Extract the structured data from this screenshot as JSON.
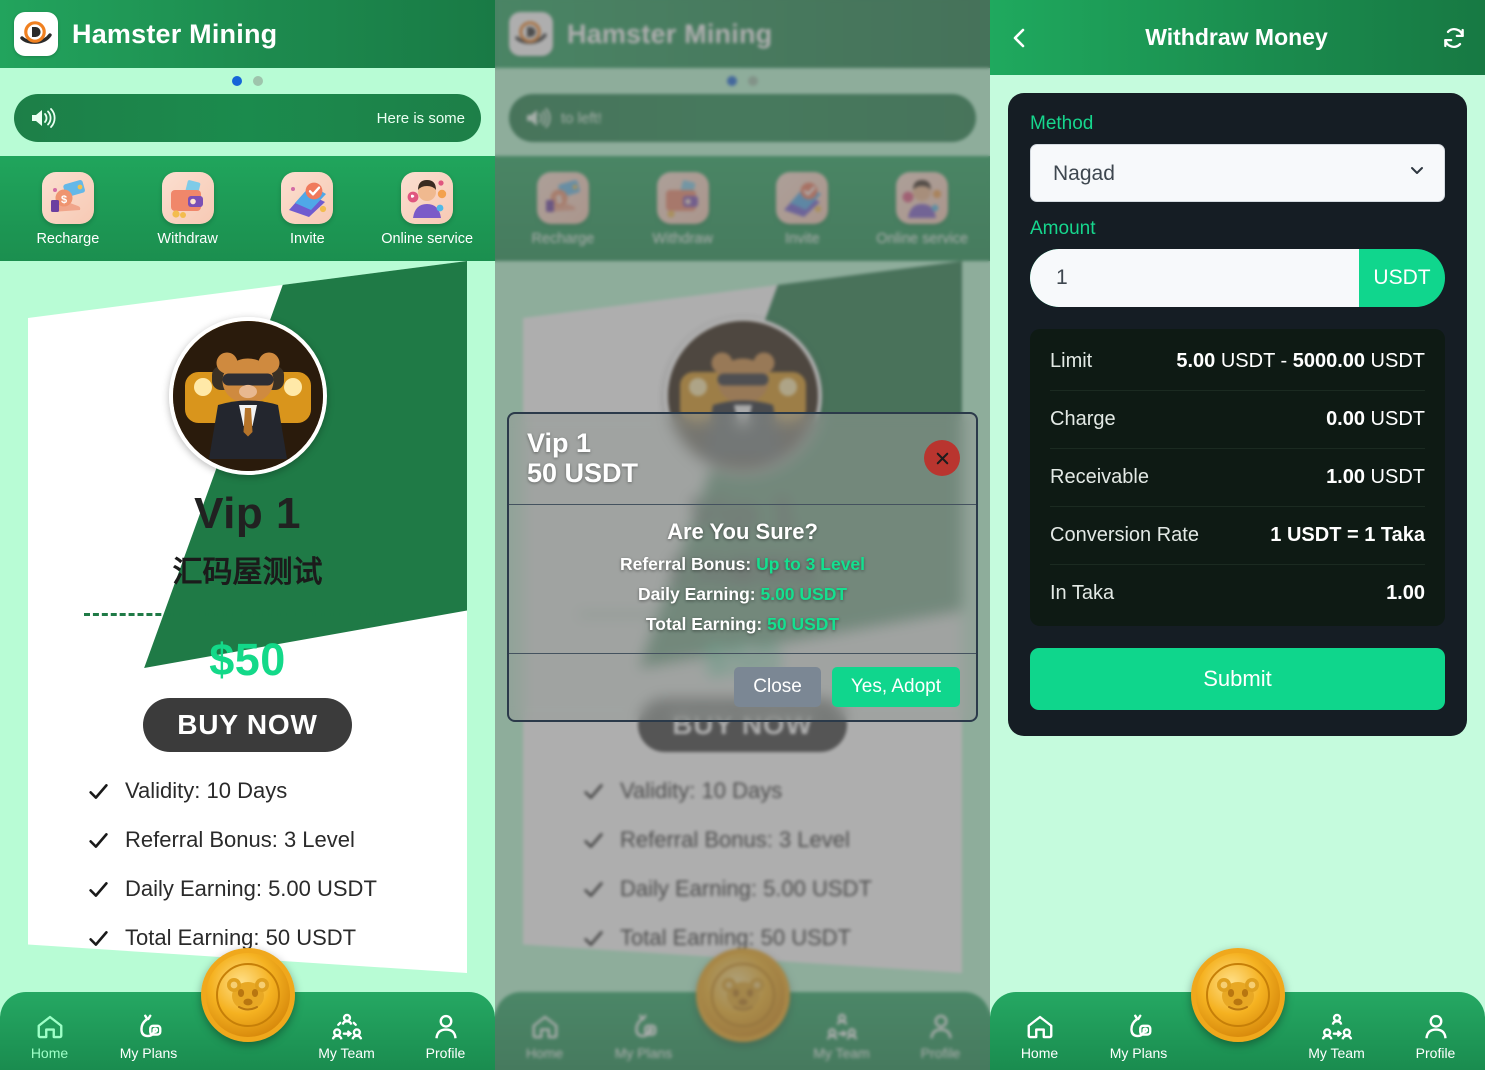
{
  "app": {
    "title": "Hamster Mining",
    "logo_icon": "brand-d-logo-icon"
  },
  "carousel": {
    "dots": 2,
    "active_index": 0
  },
  "notice_panel1": {
    "icon": "speaker-icon",
    "text": "Here is some"
  },
  "notice_panel2": {
    "icon": "speaker-icon",
    "text": "to left!"
  },
  "quick_actions": [
    {
      "label": "Recharge",
      "icon": "recharge-money-icon"
    },
    {
      "label": "Withdraw",
      "icon": "wallet-withdraw-icon"
    },
    {
      "label": "Invite",
      "icon": "invite-envelope-icon"
    },
    {
      "label": "Online service",
      "icon": "support-agent-icon"
    }
  ],
  "plan": {
    "avatar_icon": "hamster-avatar-icon",
    "name": "Vip 1",
    "subtitle": "汇码屋测试",
    "price": "$50",
    "buy_label": "BUY NOW",
    "features": [
      "Validity: 10 Days",
      "Referral Bonus: 3 Level",
      "Daily Earning: 5.00 USDT",
      "Total Earning: 50 USDT"
    ]
  },
  "modal": {
    "title": "Vip 1",
    "amount": "50 USDT",
    "close_icon": "close-x-icon",
    "confirm_heading": "Are You Sure?",
    "rows": [
      {
        "key": "Referral Bonus:",
        "value": "Up to 3 Level"
      },
      {
        "key": "Daily Earning:",
        "value": "5.00 USDT"
      },
      {
        "key": "Total Earning:",
        "value": "50 USDT"
      }
    ],
    "close_label": "Close",
    "adopt_label": "Yes, Adopt"
  },
  "withdraw": {
    "back_icon": "chevron-left-icon",
    "title": "Withdraw Money",
    "refresh_icon": "refresh-icon",
    "method_label": "Method",
    "method_value": "Nagad",
    "method_options": [
      "Nagad"
    ],
    "method_chevron_icon": "chevron-down-icon",
    "amount_label": "Amount",
    "amount_value": "1",
    "amount_placeholder": "1",
    "currency": "USDT",
    "info_rows": [
      {
        "key": "Limit",
        "strong1": "5.00",
        "mid": " USDT - ",
        "strong2": "5000.00",
        "tail": " USDT"
      },
      {
        "key": "Charge",
        "strong1": "0.00",
        "mid": "",
        "strong2": "",
        "tail": " USDT"
      },
      {
        "key": "Receivable",
        "strong1": "1.00",
        "mid": "",
        "strong2": "",
        "tail": " USDT"
      },
      {
        "key": "Conversion Rate",
        "strong1": "1 USDT = 1 Taka",
        "mid": "",
        "strong2": "",
        "tail": ""
      },
      {
        "key": "In Taka",
        "strong1": "1.00",
        "mid": "",
        "strong2": "",
        "tail": ""
      }
    ],
    "submit_label": "Submit"
  },
  "tabbar": {
    "items": [
      {
        "label": "Home",
        "icon": "home-icon",
        "active": true
      },
      {
        "label": "My Plans",
        "icon": "money-bag-icon",
        "active": false
      },
      {
        "label": "My Team",
        "icon": "team-icon",
        "active": false
      },
      {
        "label": "Profile",
        "icon": "person-icon",
        "active": false
      }
    ],
    "center_icon": "hamster-coin-icon"
  },
  "colors": {
    "brand_green": "#1f9a58",
    "mint_bg": "#b8fcd5",
    "accent_green": "#10d68d",
    "dark_card": "#151d24",
    "dark_info": "#0e1a14",
    "close_red": "#b9352f",
    "gray_button": "#7b8794"
  }
}
